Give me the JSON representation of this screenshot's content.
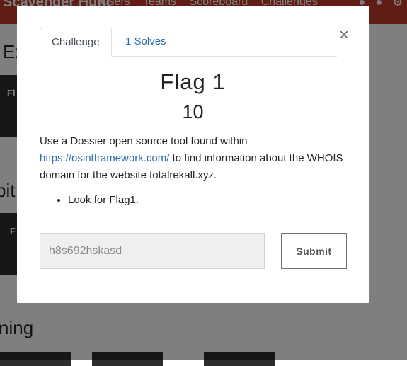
{
  "navbar": {
    "brand": "Scavenger Hunt",
    "links": [
      "Users",
      "Teams",
      "Scoreboard",
      "Challenges"
    ],
    "icons": [
      "bell-icon",
      "user-icon",
      "settings-icon"
    ]
  },
  "background": {
    "headings": [
      "Ex",
      "bit",
      "ning"
    ],
    "cards": [
      "Fl",
      "F"
    ]
  },
  "modal": {
    "tabs": {
      "challenge": "Challenge",
      "solves": "1 Solves"
    },
    "close_label": "×",
    "title": "Flag 1",
    "value": "10",
    "description": {
      "before": "Use a Dossier open source tool found within",
      "link": "https://osintframework.com/",
      "after": "to find information about the WHOIS domain for the website totalrekall.xyz."
    },
    "hints": [
      "Look for Flag1."
    ],
    "input": {
      "value": "h8s692hskasd"
    },
    "submit_label": "Submit"
  }
}
